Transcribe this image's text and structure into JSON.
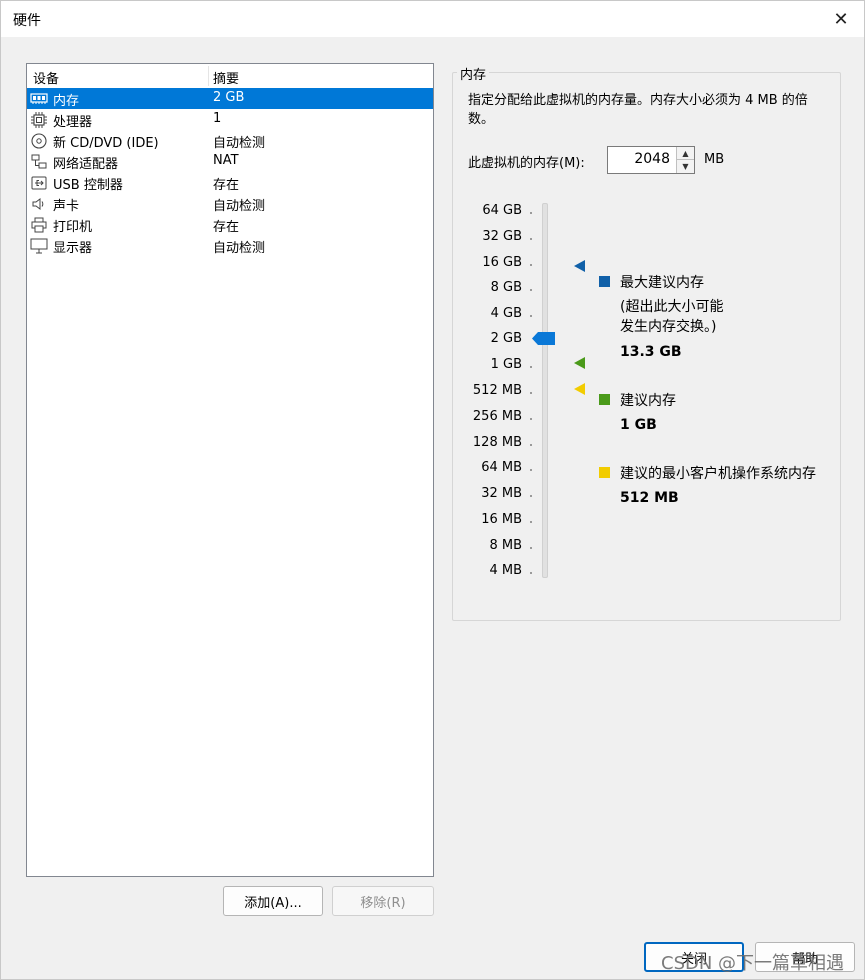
{
  "window": {
    "title": "硬件",
    "close_glyph": "✕"
  },
  "device_list": {
    "headers": {
      "device": "设备",
      "summary": "摘要"
    },
    "rows": [
      {
        "name": "内存",
        "summary": "2 GB",
        "icon": "memory-icon"
      },
      {
        "name": "处理器",
        "summary": "1",
        "icon": "processor-icon"
      },
      {
        "name": "新 CD/DVD (IDE)",
        "summary": "自动检测",
        "icon": "cd-dvd-icon"
      },
      {
        "name": "网络适配器",
        "summary": "NAT",
        "icon": "network-adapter-icon"
      },
      {
        "name": "USB 控制器",
        "summary": "存在",
        "icon": "usb-icon"
      },
      {
        "name": "声卡",
        "summary": "自动检测",
        "icon": "sound-icon"
      },
      {
        "name": "打印机",
        "summary": "存在",
        "icon": "printer-icon"
      },
      {
        "name": "显示器",
        "summary": "自动检测",
        "icon": "display-icon"
      }
    ],
    "selected_index": 0
  },
  "buttons": {
    "add": "添加(A)...",
    "remove": "移除(R)",
    "close": "关闭",
    "help": "帮助"
  },
  "memory": {
    "group_title": "内存",
    "description": "指定分配给此虚拟机的内存量。内存大小必须为 4 MB 的倍数。",
    "field_label": "此虚拟机的内存(M):",
    "value": "2048",
    "unit": "MB",
    "scale_ticks": [
      "64 GB",
      "32 GB",
      "16 GB",
      "8 GB",
      "4 GB",
      "2 GB",
      "1 GB",
      "512 MB",
      "256 MB",
      "128 MB",
      "64 MB",
      "32 MB",
      "16 MB",
      "8 MB",
      "4 MB"
    ],
    "legend": {
      "max": {
        "label": "最大建议内存",
        "note_line1": "(超出此大小可能",
        "note_line2": "发生内存交换。)",
        "value": "13.3 GB",
        "color": "#1060a8"
      },
      "recommended": {
        "label": "建议内存",
        "value": "1 GB",
        "color": "#4a9a1a"
      },
      "min": {
        "label": "建议的最小客户机操作系统内存",
        "value": "512 MB",
        "color": "#f2cc00"
      }
    },
    "slider_color": "#0a78d7"
  },
  "watermark": "CSDN @下一篇草相遇"
}
